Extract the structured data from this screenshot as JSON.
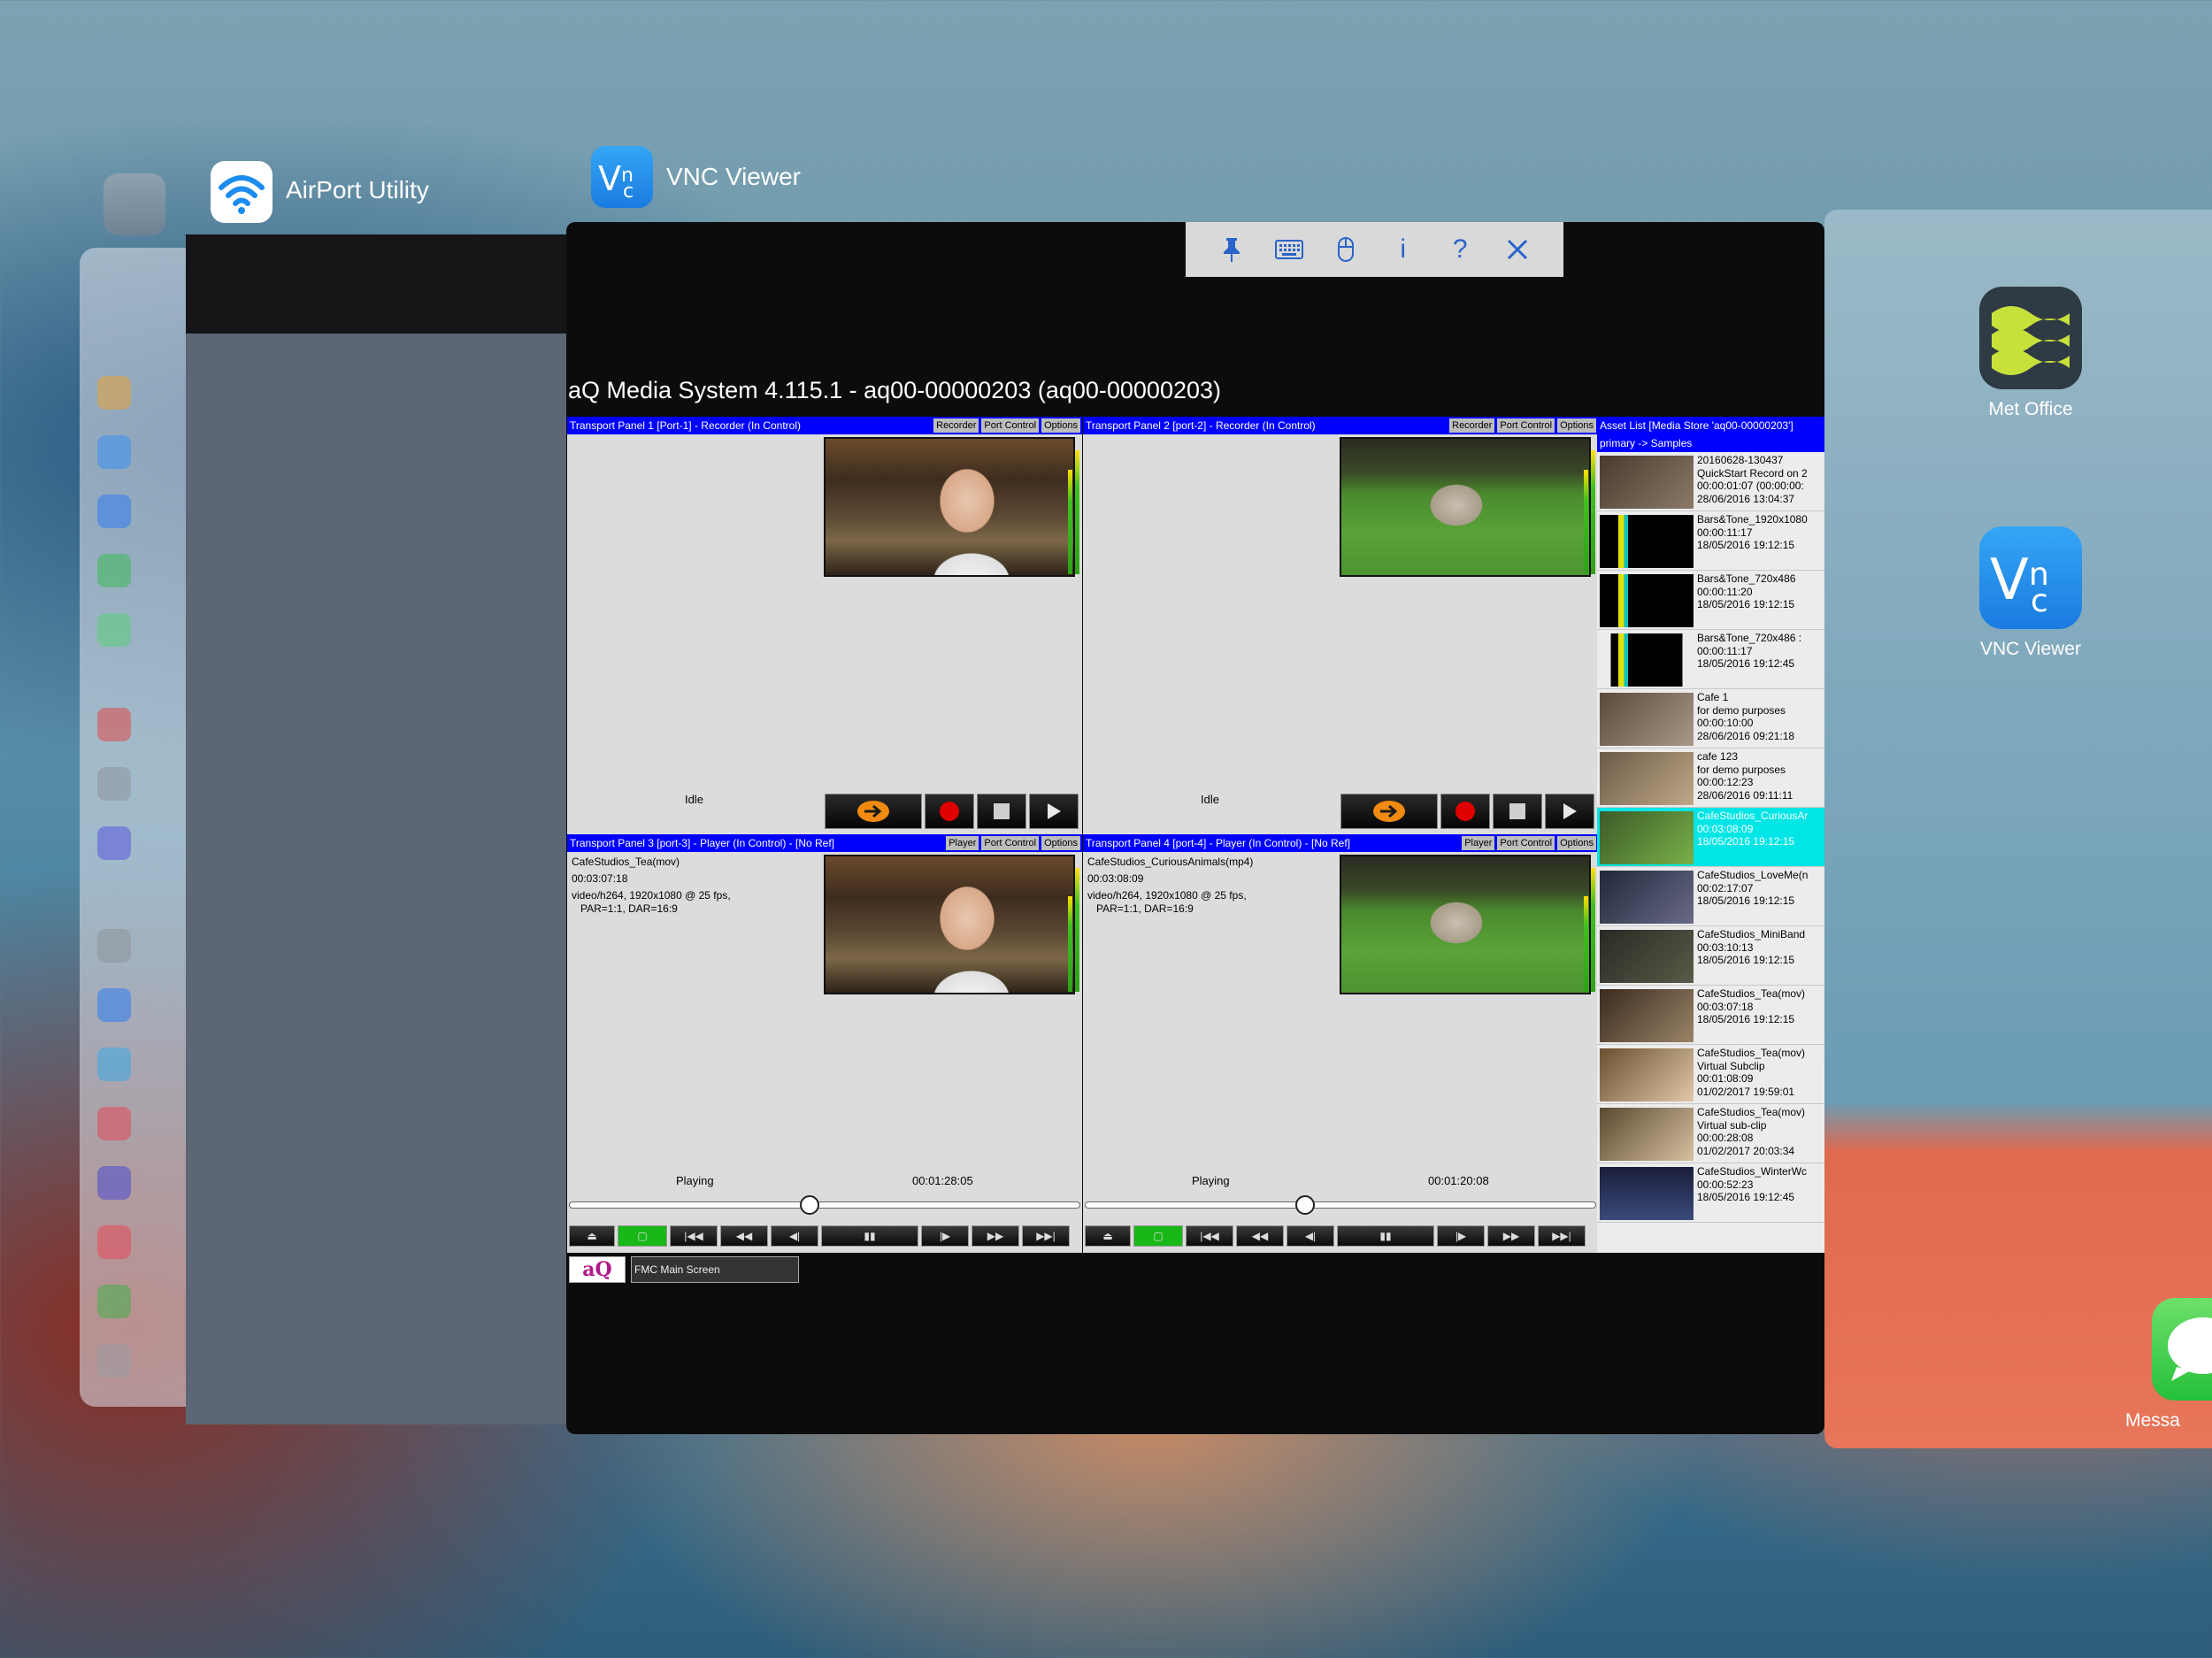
{
  "switcher": {
    "airport_title": "AirPort Utility",
    "vnc_title": "VNC Viewer",
    "home_apps": [
      {
        "label": "Met Office"
      },
      {
        "label": "VNC Viewer"
      },
      {
        "label": "Messa"
      }
    ]
  },
  "vnc_toolbar": {
    "icons": [
      "pin-icon",
      "keyboard-icon",
      "mouse-icon",
      "info-icon",
      "help-icon",
      "close-icon"
    ],
    "info_glyph": "i",
    "help_glyph": "?"
  },
  "aq": {
    "title": "aQ Media System 4.115.1 - aq00-00000203 (aq00-00000203)",
    "panels": [
      {
        "header": "Transport Panel 1 [Port-1] - Recorder (In Control)",
        "mode_btn": "Recorder",
        "port_btn": "Port Control",
        "options_btn": "Options",
        "status": "Idle"
      },
      {
        "header": "Transport Panel 2 [port-2] - Recorder (In Control)",
        "mode_btn": "Recorder",
        "port_btn": "Port Control",
        "options_btn": "Options",
        "status": "Idle"
      },
      {
        "header": "Transport Panel 3 [port-3] - Player (In Control) - [No Ref]",
        "mode_btn": "Player",
        "port_btn": "Port Control",
        "options_btn": "Options",
        "clip": "CafeStudios_Tea(mov)",
        "duration": "00:03:07:18",
        "format1": "video/h264, 1920x1080 @ 25 fps,",
        "format2": "PAR=1:1, DAR=16:9",
        "status": "Playing",
        "timecode": "00:01:28:05",
        "position": 0.47
      },
      {
        "header": "Transport Panel 4 [port-4] - Player (In Control) - [No Ref]",
        "mode_btn": "Player",
        "port_btn": "Port Control",
        "options_btn": "Options",
        "clip": "CafeStudios_CuriousAnimals(mp4)",
        "duration": "00:03:08:09",
        "format1": "video/h264, 1920x1080 @ 25 fps,",
        "format2": "PAR=1:1, DAR=16:9",
        "status": "Playing",
        "timecode": "00:01:20:08",
        "position": 0.43
      }
    ],
    "asset_list": {
      "header1": "Asset List [Media Store 'aq00-00000203']",
      "header2": "primary -> Samples",
      "items": [
        {
          "lines": [
            "20160628-130437",
            "QuickStart Record on 2",
            "00:00:01:07 (00:00:00:",
            "28/06/2016 13:04:37"
          ]
        },
        {
          "lines": [
            "Bars&Tone_1920x1080",
            "00:00:11:17",
            "18/05/2016 19:12:15"
          ]
        },
        {
          "lines": [
            "Bars&Tone_720x486",
            "00:00:11:20",
            "18/05/2016 19:12:15"
          ]
        },
        {
          "lines": [
            "Bars&Tone_720x486 :",
            "00:00:11:17",
            "18/05/2016 19:12:45"
          ]
        },
        {
          "lines": [
            "Cafe 1",
            "for demo purposes",
            "00:00:10:00",
            "28/06/2016 09:21:18"
          ]
        },
        {
          "lines": [
            "cafe 123",
            "for demo purposes",
            "00:00:12:23",
            "28/06/2016 09:11:11"
          ]
        },
        {
          "lines": [
            "CafeStudios_CuriousAr",
            "00:03:08:09",
            "18/05/2016 19:12:15"
          ],
          "selected": true
        },
        {
          "lines": [
            "CafeStudios_LoveMe(n",
            "00:02:17:07",
            "18/05/2016 19:12:15"
          ]
        },
        {
          "lines": [
            "CafeStudios_MiniBand",
            "00:03:10:13",
            "18/05/2016 19:12:15"
          ]
        },
        {
          "lines": [
            "CafeStudios_Tea(mov)",
            "00:03:07:18",
            "18/05/2016 19:12:15"
          ]
        },
        {
          "lines": [
            "CafeStudios_Tea(mov)",
            "Virtual Subclip",
            "00:01:08:09",
            "01/02/2017 19:59:01"
          ]
        },
        {
          "lines": [
            "CafeStudios_Tea(mov)",
            "Virtual sub-clip",
            "00:00:28:08",
            "01/02/2017 20:03:34"
          ]
        },
        {
          "lines": [
            "CafeStudios_WinterWc",
            "00:00:52:23",
            "18/05/2016 19:12:45"
          ]
        }
      ]
    },
    "bottom": {
      "logo": "aQ",
      "screen": "FMC Main Screen"
    }
  },
  "colors": {
    "header_blue": "#0000ff",
    "selected_cyan": "#00e5e5",
    "record_red": "#e00000",
    "play_green": "#18b818"
  }
}
